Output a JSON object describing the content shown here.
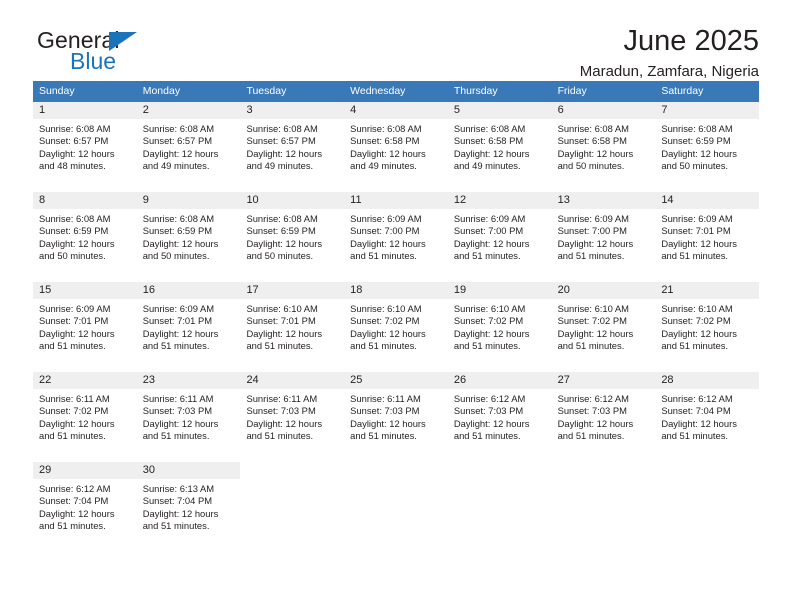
{
  "brand": {
    "name_part1": "General",
    "name_part2": "Blue"
  },
  "header": {
    "title": "June 2025",
    "location": "Maradun, Zamfara, Nigeria"
  },
  "colors": {
    "header_blue": "#3a79b8",
    "rule_blue": "#2e6da4",
    "date_band": "#efefef",
    "brand_blue": "#1b74bb",
    "text": "#231f20"
  },
  "weekdays": [
    "Sunday",
    "Monday",
    "Tuesday",
    "Wednesday",
    "Thursday",
    "Friday",
    "Saturday"
  ],
  "weeks": [
    [
      {
        "day": "1",
        "sunrise": "Sunrise: 6:08 AM",
        "sunset": "Sunset: 6:57 PM",
        "daylight1": "Daylight: 12 hours",
        "daylight2": "and 48 minutes."
      },
      {
        "day": "2",
        "sunrise": "Sunrise: 6:08 AM",
        "sunset": "Sunset: 6:57 PM",
        "daylight1": "Daylight: 12 hours",
        "daylight2": "and 49 minutes."
      },
      {
        "day": "3",
        "sunrise": "Sunrise: 6:08 AM",
        "sunset": "Sunset: 6:57 PM",
        "daylight1": "Daylight: 12 hours",
        "daylight2": "and 49 minutes."
      },
      {
        "day": "4",
        "sunrise": "Sunrise: 6:08 AM",
        "sunset": "Sunset: 6:58 PM",
        "daylight1": "Daylight: 12 hours",
        "daylight2": "and 49 minutes."
      },
      {
        "day": "5",
        "sunrise": "Sunrise: 6:08 AM",
        "sunset": "Sunset: 6:58 PM",
        "daylight1": "Daylight: 12 hours",
        "daylight2": "and 49 minutes."
      },
      {
        "day": "6",
        "sunrise": "Sunrise: 6:08 AM",
        "sunset": "Sunset: 6:58 PM",
        "daylight1": "Daylight: 12 hours",
        "daylight2": "and 50 minutes."
      },
      {
        "day": "7",
        "sunrise": "Sunrise: 6:08 AM",
        "sunset": "Sunset: 6:59 PM",
        "daylight1": "Daylight: 12 hours",
        "daylight2": "and 50 minutes."
      }
    ],
    [
      {
        "day": "8",
        "sunrise": "Sunrise: 6:08 AM",
        "sunset": "Sunset: 6:59 PM",
        "daylight1": "Daylight: 12 hours",
        "daylight2": "and 50 minutes."
      },
      {
        "day": "9",
        "sunrise": "Sunrise: 6:08 AM",
        "sunset": "Sunset: 6:59 PM",
        "daylight1": "Daylight: 12 hours",
        "daylight2": "and 50 minutes."
      },
      {
        "day": "10",
        "sunrise": "Sunrise: 6:08 AM",
        "sunset": "Sunset: 6:59 PM",
        "daylight1": "Daylight: 12 hours",
        "daylight2": "and 50 minutes."
      },
      {
        "day": "11",
        "sunrise": "Sunrise: 6:09 AM",
        "sunset": "Sunset: 7:00 PM",
        "daylight1": "Daylight: 12 hours",
        "daylight2": "and 51 minutes."
      },
      {
        "day": "12",
        "sunrise": "Sunrise: 6:09 AM",
        "sunset": "Sunset: 7:00 PM",
        "daylight1": "Daylight: 12 hours",
        "daylight2": "and 51 minutes."
      },
      {
        "day": "13",
        "sunrise": "Sunrise: 6:09 AM",
        "sunset": "Sunset: 7:00 PM",
        "daylight1": "Daylight: 12 hours",
        "daylight2": "and 51 minutes."
      },
      {
        "day": "14",
        "sunrise": "Sunrise: 6:09 AM",
        "sunset": "Sunset: 7:01 PM",
        "daylight1": "Daylight: 12 hours",
        "daylight2": "and 51 minutes."
      }
    ],
    [
      {
        "day": "15",
        "sunrise": "Sunrise: 6:09 AM",
        "sunset": "Sunset: 7:01 PM",
        "daylight1": "Daylight: 12 hours",
        "daylight2": "and 51 minutes."
      },
      {
        "day": "16",
        "sunrise": "Sunrise: 6:09 AM",
        "sunset": "Sunset: 7:01 PM",
        "daylight1": "Daylight: 12 hours",
        "daylight2": "and 51 minutes."
      },
      {
        "day": "17",
        "sunrise": "Sunrise: 6:10 AM",
        "sunset": "Sunset: 7:01 PM",
        "daylight1": "Daylight: 12 hours",
        "daylight2": "and 51 minutes."
      },
      {
        "day": "18",
        "sunrise": "Sunrise: 6:10 AM",
        "sunset": "Sunset: 7:02 PM",
        "daylight1": "Daylight: 12 hours",
        "daylight2": "and 51 minutes."
      },
      {
        "day": "19",
        "sunrise": "Sunrise: 6:10 AM",
        "sunset": "Sunset: 7:02 PM",
        "daylight1": "Daylight: 12 hours",
        "daylight2": "and 51 minutes."
      },
      {
        "day": "20",
        "sunrise": "Sunrise: 6:10 AM",
        "sunset": "Sunset: 7:02 PM",
        "daylight1": "Daylight: 12 hours",
        "daylight2": "and 51 minutes."
      },
      {
        "day": "21",
        "sunrise": "Sunrise: 6:10 AM",
        "sunset": "Sunset: 7:02 PM",
        "daylight1": "Daylight: 12 hours",
        "daylight2": "and 51 minutes."
      }
    ],
    [
      {
        "day": "22",
        "sunrise": "Sunrise: 6:11 AM",
        "sunset": "Sunset: 7:02 PM",
        "daylight1": "Daylight: 12 hours",
        "daylight2": "and 51 minutes."
      },
      {
        "day": "23",
        "sunrise": "Sunrise: 6:11 AM",
        "sunset": "Sunset: 7:03 PM",
        "daylight1": "Daylight: 12 hours",
        "daylight2": "and 51 minutes."
      },
      {
        "day": "24",
        "sunrise": "Sunrise: 6:11 AM",
        "sunset": "Sunset: 7:03 PM",
        "daylight1": "Daylight: 12 hours",
        "daylight2": "and 51 minutes."
      },
      {
        "day": "25",
        "sunrise": "Sunrise: 6:11 AM",
        "sunset": "Sunset: 7:03 PM",
        "daylight1": "Daylight: 12 hours",
        "daylight2": "and 51 minutes."
      },
      {
        "day": "26",
        "sunrise": "Sunrise: 6:12 AM",
        "sunset": "Sunset: 7:03 PM",
        "daylight1": "Daylight: 12 hours",
        "daylight2": "and 51 minutes."
      },
      {
        "day": "27",
        "sunrise": "Sunrise: 6:12 AM",
        "sunset": "Sunset: 7:03 PM",
        "daylight1": "Daylight: 12 hours",
        "daylight2": "and 51 minutes."
      },
      {
        "day": "28",
        "sunrise": "Sunrise: 6:12 AM",
        "sunset": "Sunset: 7:04 PM",
        "daylight1": "Daylight: 12 hours",
        "daylight2": "and 51 minutes."
      }
    ],
    [
      {
        "day": "29",
        "sunrise": "Sunrise: 6:12 AM",
        "sunset": "Sunset: 7:04 PM",
        "daylight1": "Daylight: 12 hours",
        "daylight2": "and 51 minutes."
      },
      {
        "day": "30",
        "sunrise": "Sunrise: 6:13 AM",
        "sunset": "Sunset: 7:04 PM",
        "daylight1": "Daylight: 12 hours",
        "daylight2": "and 51 minutes."
      },
      {
        "day": "",
        "sunrise": "",
        "sunset": "",
        "daylight1": "",
        "daylight2": ""
      },
      {
        "day": "",
        "sunrise": "",
        "sunset": "",
        "daylight1": "",
        "daylight2": ""
      },
      {
        "day": "",
        "sunrise": "",
        "sunset": "",
        "daylight1": "",
        "daylight2": ""
      },
      {
        "day": "",
        "sunrise": "",
        "sunset": "",
        "daylight1": "",
        "daylight2": ""
      },
      {
        "day": "",
        "sunrise": "",
        "sunset": "",
        "daylight1": "",
        "daylight2": ""
      }
    ]
  ]
}
